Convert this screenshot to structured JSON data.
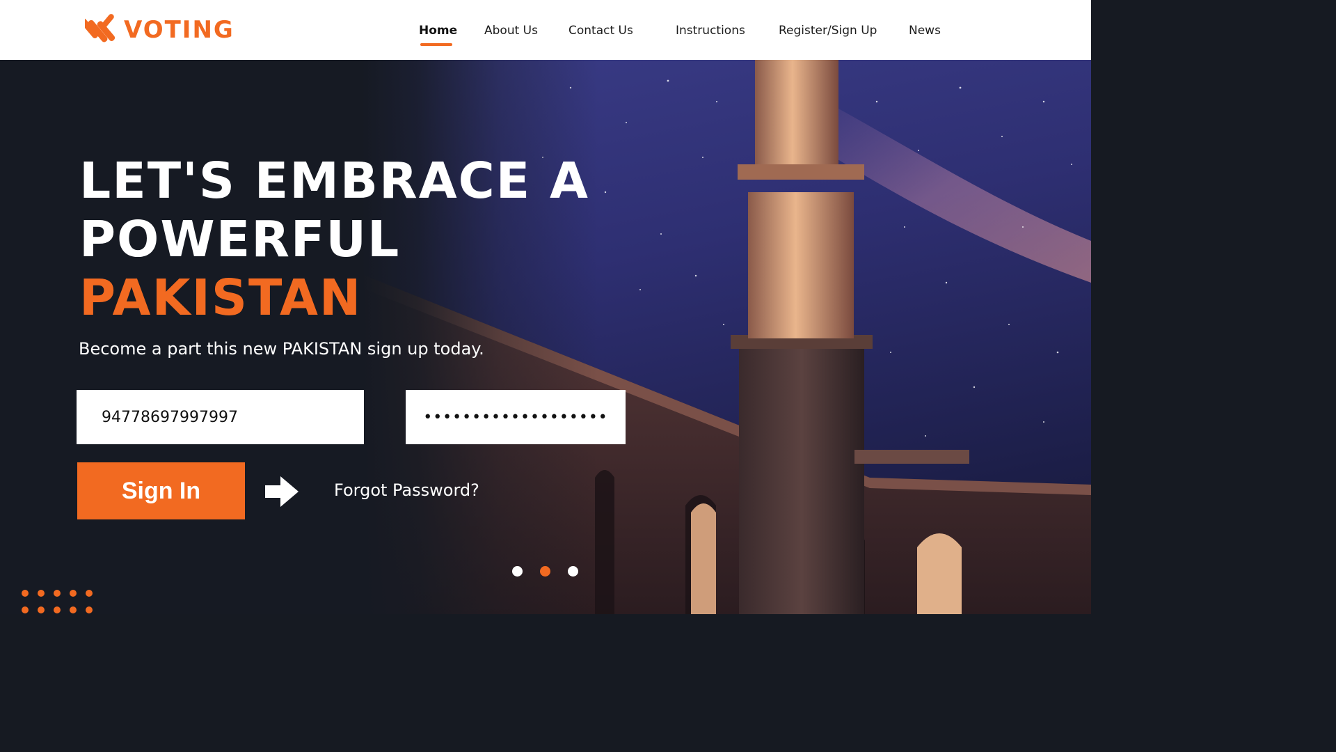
{
  "brand": {
    "name": "VOTING",
    "accent_color": "#f26a21"
  },
  "nav": {
    "items": [
      {
        "label": "Home",
        "active": true
      },
      {
        "label": "About Us",
        "active": false
      },
      {
        "label": "Contact Us",
        "active": false
      },
      {
        "label": "Instructions",
        "active": false
      },
      {
        "label": "Register/Sign Up",
        "active": false
      },
      {
        "label": "News",
        "active": false
      }
    ]
  },
  "hero": {
    "headline_line1": "LET'S EMBRACE A",
    "headline_line2": "POWERFUL",
    "headline_accent": "PAKISTAN",
    "subtitle": "Become a part this new PAKISTAN sign up today.",
    "background": "night-sky-minaret-image"
  },
  "login": {
    "id_value": "94778697997997",
    "password_value": "•••••••••••••••••••",
    "signin_label": "Sign In",
    "arrow_icon": "arrow-right-icon",
    "forgot_label": "Forgot Password?"
  },
  "slider": {
    "count": 3,
    "active_index": 1,
    "active_color": "#f26a21",
    "inactive_color": "#ffffff"
  }
}
